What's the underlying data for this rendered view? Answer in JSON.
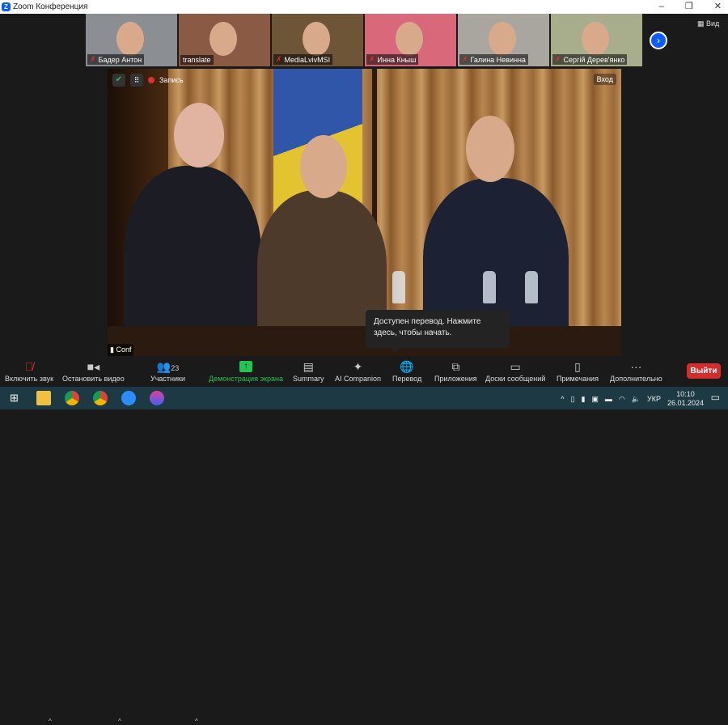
{
  "window": {
    "title": "Zoom Конференция",
    "minimize": "–",
    "maximize": "❐",
    "close": "✕"
  },
  "participants_strip": [
    {
      "name": "Бадер Антон",
      "muted": true,
      "bg": "#8b8f93"
    },
    {
      "name": "translate",
      "muted": false,
      "bg": "#8a5a44"
    },
    {
      "name": "MediaLvivMSI",
      "muted": true,
      "bg": "#6e5538"
    },
    {
      "name": "Инна Кныш",
      "muted": true,
      "bg": "#d8687a"
    },
    {
      "name": "Галина Невинна",
      "muted": true,
      "bg": "#a9a6a0"
    },
    {
      "name": "Сергій Дерев'янко",
      "muted": true,
      "bg": "#a8ae8c"
    }
  ],
  "view_label": "Вид",
  "next_icon": "›",
  "video": {
    "recording_label": "Запись",
    "login_label": "Вход",
    "name_label": "Conf"
  },
  "tooltip": "Доступен перевод. Нажмите здесь, чтобы начать.",
  "toolbar": {
    "audio": "Включить звук",
    "video": "Остановить видео",
    "participants": "Участники",
    "participants_count": "23",
    "share": "Демонстрация экрана",
    "summary": "Summary",
    "ai": "AI Companion",
    "translate": "Перевод",
    "apps": "Приложения",
    "boards": "Доски сообщений",
    "notes": "Примечания",
    "more": "Дополнительно",
    "leave": "Выйти"
  },
  "taskbar": {
    "lang": "УКР",
    "time": "10:10",
    "date": "26.01.2024"
  },
  "colors": {
    "accent": "#0b5cff",
    "share_green": "#23c552",
    "leave_red": "#d22e2e"
  }
}
